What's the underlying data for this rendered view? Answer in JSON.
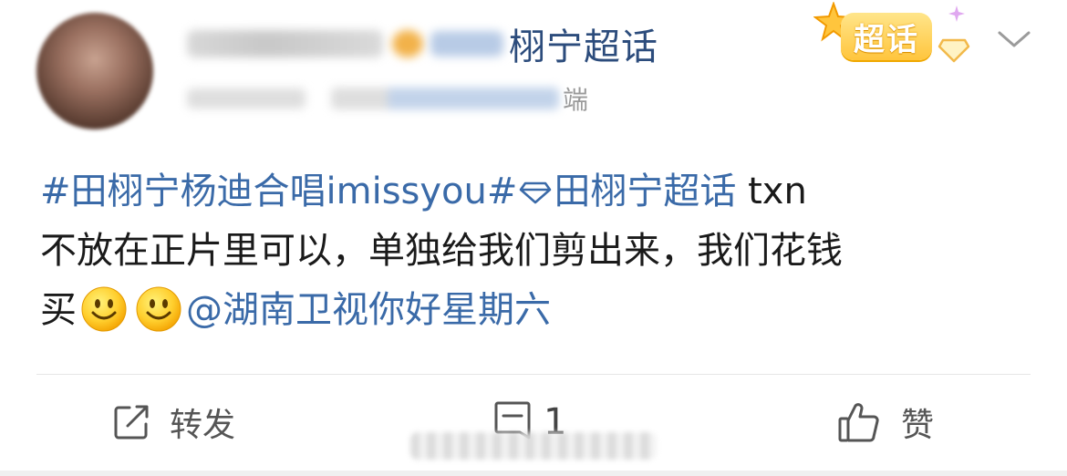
{
  "header": {
    "source_text": "栩宁超话",
    "meta_suffix": "端",
    "super_badge_label": "超话"
  },
  "post": {
    "topic1": "#田栩宁杨迪合唱imissyou#",
    "topic2": "田栩宁超话",
    "tail": " txn",
    "line2": "不放在正片里可以，单独给我们剪出来，我们花钱",
    "line3_prefix": "买",
    "emoji_icon": "smile-emoji",
    "mention": "@湖南卫视你好星期六"
  },
  "actions": {
    "repost_label": "转发",
    "comment_count": "1",
    "like_label": "赞"
  },
  "colors": {
    "link": "#3a6aa8",
    "text": "#1a1a1a",
    "action_text": "#555555",
    "badge_gold": "#ffc53d"
  }
}
